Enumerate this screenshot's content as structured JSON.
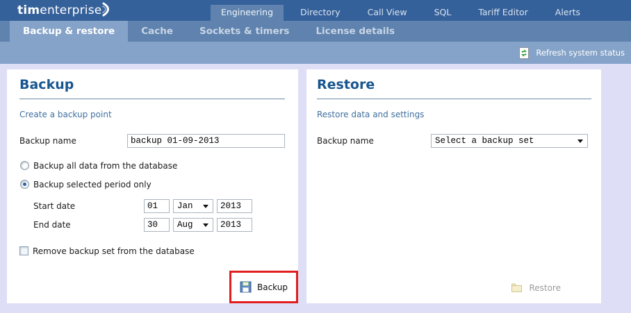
{
  "logo": {
    "bold": "tim",
    "rest": "enterprise"
  },
  "top_nav": {
    "tabs": [
      {
        "label": "Engineering",
        "active": true
      },
      {
        "label": "Directory",
        "active": false
      },
      {
        "label": "Call View",
        "active": false
      },
      {
        "label": "SQL",
        "active": false
      },
      {
        "label": "Tariff Editor",
        "active": false
      },
      {
        "label": "Alerts",
        "active": false
      }
    ]
  },
  "sub_nav": {
    "tabs": [
      {
        "label": "Backup & restore",
        "active": true
      },
      {
        "label": "Cache",
        "active": false
      },
      {
        "label": "Sockets & timers",
        "active": false
      },
      {
        "label": "License details",
        "active": false
      }
    ]
  },
  "status_bar": {
    "refresh_label": "Refresh system status"
  },
  "backup_panel": {
    "title": "Backup",
    "subtitle": "Create a backup point",
    "backup_name_label": "Backup name",
    "backup_name_value": "backup 01-09-2013",
    "radio_all": {
      "label": "Backup all data from the database",
      "checked": false
    },
    "radio_period": {
      "label": "Backup selected period only",
      "checked": true
    },
    "start_date": {
      "label": "Start date",
      "day": "01",
      "month": "Jan",
      "year": "2013"
    },
    "end_date": {
      "label": "End date",
      "day": "30",
      "month": "Aug",
      "year": "2013"
    },
    "remove_checkbox": {
      "label": "Remove backup set from the database",
      "checked": false
    },
    "button_label": "Backup",
    "button_highlighted": true
  },
  "restore_panel": {
    "title": "Restore",
    "subtitle": "Restore data and settings",
    "backup_name_label": "Backup name",
    "select_value": "Select a backup set",
    "button_label": "Restore",
    "button_disabled": true
  },
  "colors": {
    "topbar": "#35619b",
    "subnav": "#5f83ae",
    "statusbar": "#85a3c8",
    "page_background": "#dedef6",
    "panel_title": "#17568f",
    "link_blue": "#3f6f9f",
    "annotation_red": "#e11d1d"
  }
}
